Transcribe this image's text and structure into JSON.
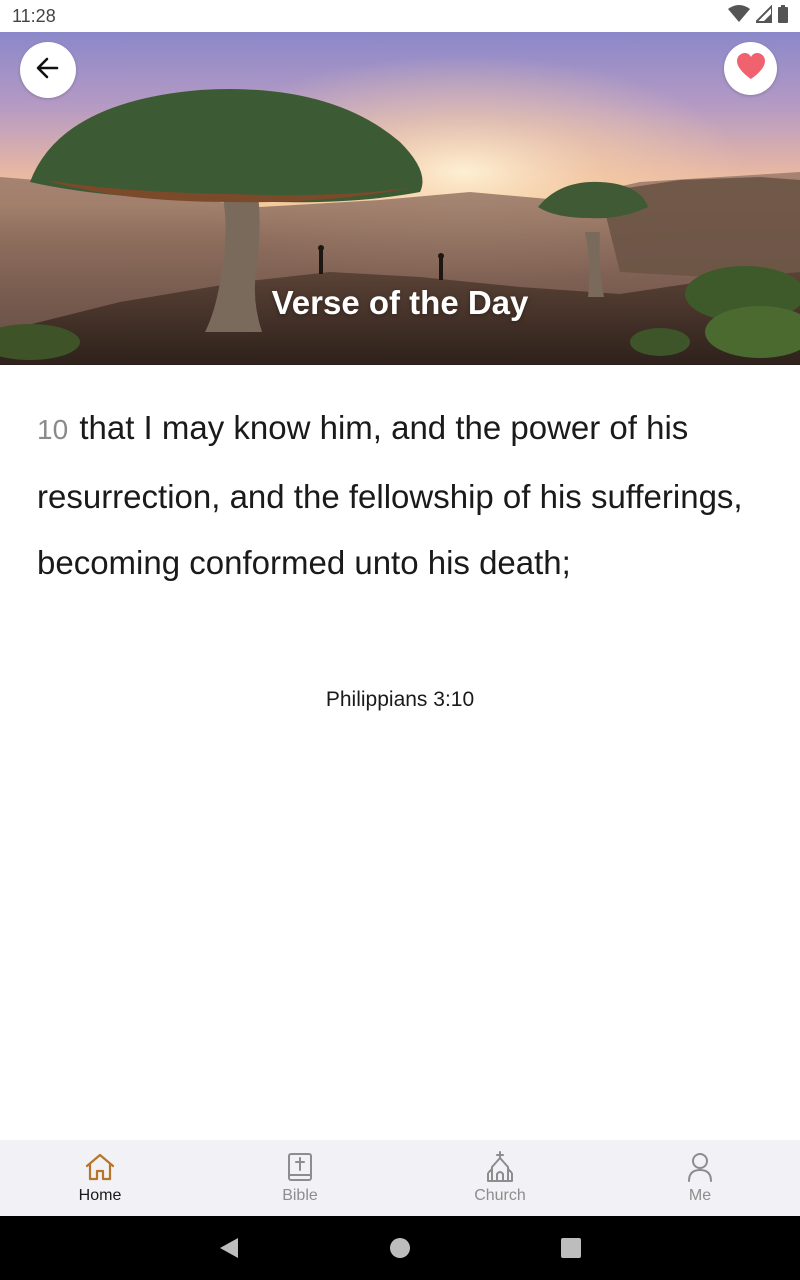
{
  "status_bar": {
    "time": "11:28",
    "icons": [
      "wifi-icon",
      "signal-icon",
      "battery-icon"
    ]
  },
  "header": {
    "title": "Verse of the Day",
    "back_icon": "arrow-left-icon",
    "favorite_icon": "heart-icon",
    "favorite_color": "#f0626e"
  },
  "verse": {
    "number": "10",
    "text": "that I may know him, and the power of his resurrection, and the fellowship of his sufferings, becoming conformed unto his death;",
    "reference": "Philippians 3:10"
  },
  "bottom_nav": {
    "active_color": "#b7752a",
    "items": [
      {
        "label": "Home",
        "icon": "home-icon",
        "active": true
      },
      {
        "label": "Bible",
        "icon": "bible-icon",
        "active": false
      },
      {
        "label": "Church",
        "icon": "church-icon",
        "active": false
      },
      {
        "label": "Me",
        "icon": "person-icon",
        "active": false
      }
    ]
  },
  "system_nav": {
    "icons": [
      "back-triangle-icon",
      "home-circle-icon",
      "recents-square-icon"
    ]
  }
}
